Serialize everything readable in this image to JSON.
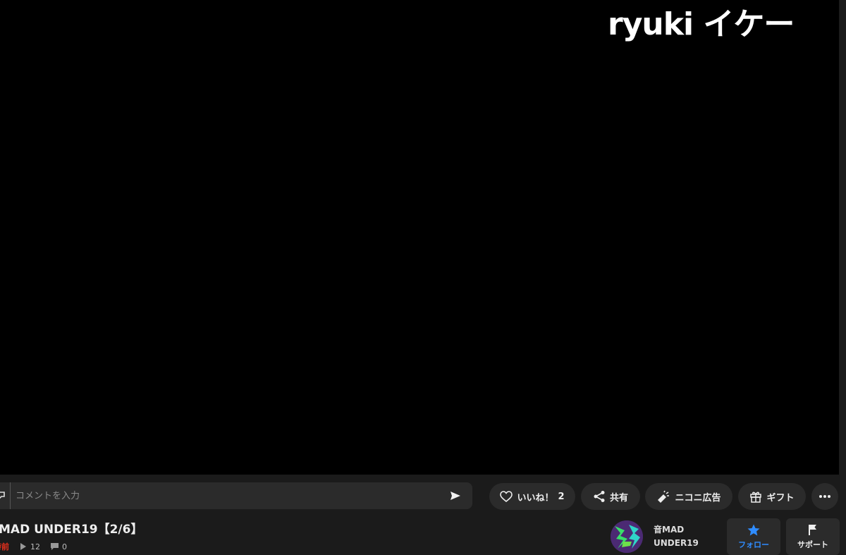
{
  "video": {
    "overlay_text": "ryuki イケー"
  },
  "comment": {
    "placeholder": "コメントを入力"
  },
  "actions": {
    "like_label": "いいね！",
    "like_count": "2",
    "share_label": "共有",
    "nicoad_label": "ニコニ広告",
    "gift_label": "ギフト"
  },
  "info": {
    "title": "MAD UNDER19【2/6】",
    "posted": "時前",
    "views": "12",
    "comments": "0"
  },
  "owner": {
    "name": "音MAD UNDER19",
    "follow_label": "フォロー",
    "support_label": "サポート"
  },
  "colors": {
    "accent_blue": "#2f8cff",
    "posted_red": "#e8301c",
    "surface": "#2b2b2b"
  }
}
